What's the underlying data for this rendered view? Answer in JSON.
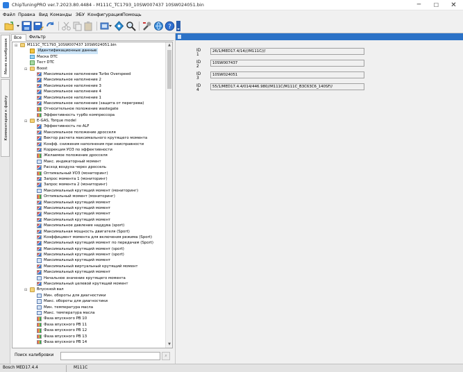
{
  "window": {
    "title": "ChipTuningPRO ver.7.2023.80.4484 - M111C_TC1793_10SW007437 10SW024051.bin",
    "minimize": "─",
    "maximize": "☐",
    "close": "✕"
  },
  "menu": [
    "Файл",
    "Правка",
    "Вид",
    "Команды",
    "ЭБУ",
    "Конфигурация",
    "Помощь"
  ],
  "side_tabs": {
    "maps": "Меню калибровок",
    "comments": "Комментарии к файлу"
  },
  "left_tabs": {
    "all": "Все",
    "filter": "Фильтр"
  },
  "tree": [
    {
      "label": "M111C_TC1793_10SW007437 10SW024051.bin",
      "level": 0,
      "icon": "folder-icon",
      "expand": "⊟"
    },
    {
      "label": "Идентификационные данные",
      "level": 1,
      "icon": "id-icon",
      "selected": true
    },
    {
      "label": "Маска DTC",
      "level": 1,
      "icon": "mask-icon"
    },
    {
      "label": "Тест DTC",
      "level": 1,
      "icon": "test-icon"
    },
    {
      "label": "Boost",
      "level": 1,
      "icon": "folder-icon",
      "expand": "⊟"
    },
    {
      "label": "Максимальное наполнение Turbo Overspeed",
      "level": 2,
      "icon": "map-icon"
    },
    {
      "label": "Максимальное наполнение 2",
      "level": 2,
      "icon": "map-icon"
    },
    {
      "label": "Максимальное наполнение 3",
      "level": 2,
      "icon": "map-icon"
    },
    {
      "label": "Максимальное наполнение 4",
      "level": 2,
      "icon": "map-icon"
    },
    {
      "label": "Максимальное наполнение 1",
      "level": 2,
      "icon": "map-icon"
    },
    {
      "label": "Максимальное наполнение (защита от перегрева)",
      "level": 2,
      "icon": "map-icon"
    },
    {
      "label": "Относительное положение wastegate",
      "level": 2,
      "icon": "map3-icon"
    },
    {
      "label": "Эффективность турбо компрессора",
      "level": 2,
      "icon": "map3-icon"
    },
    {
      "label": "E-GAS, Torque model",
      "level": 1,
      "icon": "folder-icon",
      "expand": "⊟"
    },
    {
      "label": "Эффективность по ALF",
      "level": 2,
      "icon": "map-icon"
    },
    {
      "label": "Максимальное положение дросселя",
      "level": 2,
      "icon": "map-icon"
    },
    {
      "label": "Вектор расчета максимального крутящего момента",
      "level": 2,
      "icon": "map-icon"
    },
    {
      "label": "Коэфф. снижения наполнения при неисправности",
      "level": 2,
      "icon": "map-icon"
    },
    {
      "label": "Коррекция УОЗ по эффективности",
      "level": 2,
      "icon": "map-icon"
    },
    {
      "label": "Желаемое положение дросселя",
      "level": 2,
      "icon": "map3-icon"
    },
    {
      "label": "Макс. индикаторный момент",
      "level": 2,
      "icon": "val-icon"
    },
    {
      "label": "Расход воздуха через дроссель",
      "level": 2,
      "icon": "map-icon"
    },
    {
      "label": "Оптимальный УОЗ (мониторинг)",
      "level": 2,
      "icon": "map3-icon"
    },
    {
      "label": "Запрос момента 1 (мониторинг)",
      "level": 2,
      "icon": "map-icon"
    },
    {
      "label": "Запрос момента 2 (мониторинг)",
      "level": 2,
      "icon": "map-icon"
    },
    {
      "label": "Максимальный крутящий момент (мониторинг)",
      "level": 2,
      "icon": "val-icon"
    },
    {
      "label": "Оптимальный момент (мониторинг)",
      "level": 2,
      "icon": "map3-icon"
    },
    {
      "label": "Максимальный крутящий момент",
      "level": 2,
      "icon": "map-icon"
    },
    {
      "label": "Максимальный крутящий момент",
      "level": 2,
      "icon": "map-icon"
    },
    {
      "label": "Максимальный крутящий момент",
      "level": 2,
      "icon": "map-icon"
    },
    {
      "label": "Максимальный крутящий момент",
      "level": 2,
      "icon": "map-icon"
    },
    {
      "label": "Максимальное давление наддува (sport)",
      "level": 2,
      "icon": "map-icon"
    },
    {
      "label": "Максимальная мощность двигателя (Sport)",
      "level": 2,
      "icon": "map-icon"
    },
    {
      "label": "Коэффициент момента для включения режима (Sport)",
      "level": 2,
      "icon": "map-icon"
    },
    {
      "label": "Максимальный крутящий момент по передачам (Sport)",
      "level": 2,
      "icon": "map-icon"
    },
    {
      "label": "Максимальный крутящий момент (sport)",
      "level": 2,
      "icon": "map-icon"
    },
    {
      "label": "Максимальный крутящий момент (sport)",
      "level": 2,
      "icon": "map-icon"
    },
    {
      "label": "Максимальный крутящий момент",
      "level": 2,
      "icon": "val-icon"
    },
    {
      "label": "Максимальный виртуальный крутящий момент",
      "level": 2,
      "icon": "map-icon"
    },
    {
      "label": "Максимальный крутящий момент",
      "level": 2,
      "icon": "map-icon"
    },
    {
      "label": "Начальное значение крутящего момента",
      "level": 2,
      "icon": "val-icon"
    },
    {
      "label": "Максимальный целевой крутящий момент",
      "level": 2,
      "icon": "map-icon"
    },
    {
      "label": "Впускной вал",
      "level": 1,
      "icon": "folder-icon",
      "expand": "⊟"
    },
    {
      "label": "Мин. обороты для диагностики",
      "level": 2,
      "icon": "val-icon"
    },
    {
      "label": "Макс. обороты для диагностики",
      "level": 2,
      "icon": "val-icon"
    },
    {
      "label": "Мин. температура масла",
      "level": 2,
      "icon": "val-icon"
    },
    {
      "label": "Макс. температура масла",
      "level": 2,
      "icon": "val-icon"
    },
    {
      "label": "Фаза впускного РВ 10",
      "level": 2,
      "icon": "map3-icon"
    },
    {
      "label": "Фаза впускного РВ 11",
      "level": 2,
      "icon": "map3-icon"
    },
    {
      "label": "Фаза впускного РВ 12",
      "level": 2,
      "icon": "map3-icon"
    },
    {
      "label": "Фаза впускного РВ 13",
      "level": 2,
      "icon": "map3-icon"
    },
    {
      "label": "Фаза впускного РВ 14",
      "level": 2,
      "icon": "map3-icon"
    }
  ],
  "search": {
    "label": "Поиск калибровки",
    "value": "",
    "button": "⌕"
  },
  "ids": [
    {
      "label": "ID 1",
      "value": "26/1/MED17.4/14///M111C///"
    },
    {
      "label": "ID 2",
      "value": "10SW007437"
    },
    {
      "label": "ID 3",
      "value": "10SW024051"
    },
    {
      "label": "ID 4",
      "value": "55/1/MED17.4.4/014/446.980//M111C/M111C_B3C63C6_140SF//"
    }
  ],
  "status": {
    "ecu": "Bosch MED17.4.4",
    "engine": "M111C"
  },
  "colors": {
    "header_blue": "#2b72c7",
    "selection": "#cce4f7"
  }
}
